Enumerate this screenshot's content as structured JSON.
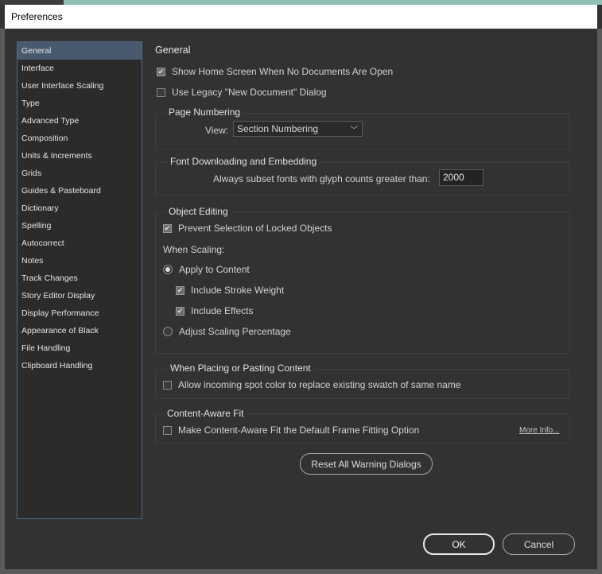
{
  "window": {
    "title": "Preferences"
  },
  "sidebar": {
    "items": [
      {
        "label": "General",
        "active": true
      },
      {
        "label": "Interface"
      },
      {
        "label": "User Interface Scaling"
      },
      {
        "label": "Type"
      },
      {
        "label": "Advanced Type"
      },
      {
        "label": "Composition"
      },
      {
        "label": "Units & Increments"
      },
      {
        "label": "Grids"
      },
      {
        "label": "Guides & Pasteboard"
      },
      {
        "label": "Dictionary"
      },
      {
        "label": "Spelling"
      },
      {
        "label": "Autocorrect"
      },
      {
        "label": "Notes"
      },
      {
        "label": "Track Changes"
      },
      {
        "label": "Story Editor Display"
      },
      {
        "label": "Display Performance"
      },
      {
        "label": "Appearance of Black"
      },
      {
        "label": "File Handling"
      },
      {
        "label": "Clipboard Handling"
      }
    ]
  },
  "general": {
    "heading": "General",
    "show_home_screen": {
      "label": "Show Home Screen When No Documents Are Open",
      "checked": true
    },
    "legacy_new_doc": {
      "label": "Use Legacy \"New Document\" Dialog",
      "checked": false
    }
  },
  "page_numbering": {
    "title": "Page Numbering",
    "view_label": "View:",
    "view_value": "Section Numbering"
  },
  "font_downloading": {
    "title": "Font Downloading and Embedding",
    "subset_label": "Always subset fonts with glyph counts greater than:",
    "subset_value": "2000"
  },
  "object_editing": {
    "title": "Object Editing",
    "prevent_locked": {
      "label": "Prevent Selection of Locked Objects",
      "checked": true
    },
    "when_scaling_label": "When Scaling:",
    "apply_to_content": {
      "label": "Apply to Content",
      "selected": true
    },
    "include_stroke": {
      "label": "Include Stroke Weight",
      "checked": true
    },
    "include_effects": {
      "label": "Include Effects",
      "checked": true
    },
    "adjust_percentage": {
      "label": "Adjust Scaling Percentage",
      "selected": false
    }
  },
  "placing": {
    "title": "When Placing or Pasting Content",
    "spot_color": {
      "label": "Allow incoming spot color to replace existing swatch of same name",
      "checked": false
    }
  },
  "content_aware": {
    "title": "Content-Aware Fit",
    "default_fitting": {
      "label": "Make Content-Aware Fit the Default Frame Fitting Option",
      "checked": false
    },
    "more_info": "More Info..."
  },
  "buttons": {
    "reset_warnings": "Reset All Warning Dialogs",
    "ok": "OK",
    "cancel": "Cancel"
  },
  "icons": {
    "check": "checkmark-icon",
    "chevron": "chevron-down-icon",
    "radio": "radio-dot-icon"
  }
}
